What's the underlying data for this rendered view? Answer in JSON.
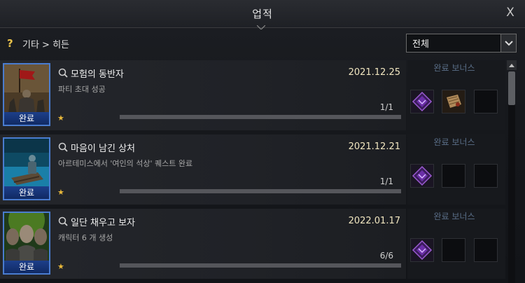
{
  "window": {
    "title": "업적",
    "close_label": "X"
  },
  "breadcrumb": {
    "help_icon": "?",
    "text": "기타 > 히든"
  },
  "filter": {
    "selected": "전체"
  },
  "colors": {
    "accent_blue": "#4a7ccf",
    "date_text": "#f1e6c0",
    "star": "#e8b83a",
    "bonus_label": "#5a6e88"
  },
  "achievements": [
    {
      "title": "모험의 동반자",
      "desc": "파티 초대 성공",
      "date": "2021.12.25",
      "progress_text": "1/1",
      "progress": 1.0,
      "status": "완료",
      "bonus_label": "완료 보너스",
      "rewards": [
        "purple-emblem-icon",
        "scroll-icon",
        "empty"
      ]
    },
    {
      "title": "마음이 남긴 상처",
      "desc": "아르테미스에서 '여인의 석상' 퀘스트 완료",
      "date": "2021.12.21",
      "progress_text": "1/1",
      "progress": 1.0,
      "status": "완료",
      "bonus_label": "완료 보너스",
      "rewards": [
        "purple-emblem-icon",
        "empty",
        "empty"
      ]
    },
    {
      "title": "일단 채우고 보자",
      "desc": "캐릭터 6 개 생성",
      "date": "2022.01.17",
      "progress_text": "6/6",
      "progress": 1.0,
      "status": "완료",
      "bonus_label": "완료 보너스",
      "rewards": [
        "purple-emblem-icon",
        "empty",
        "empty"
      ]
    }
  ]
}
